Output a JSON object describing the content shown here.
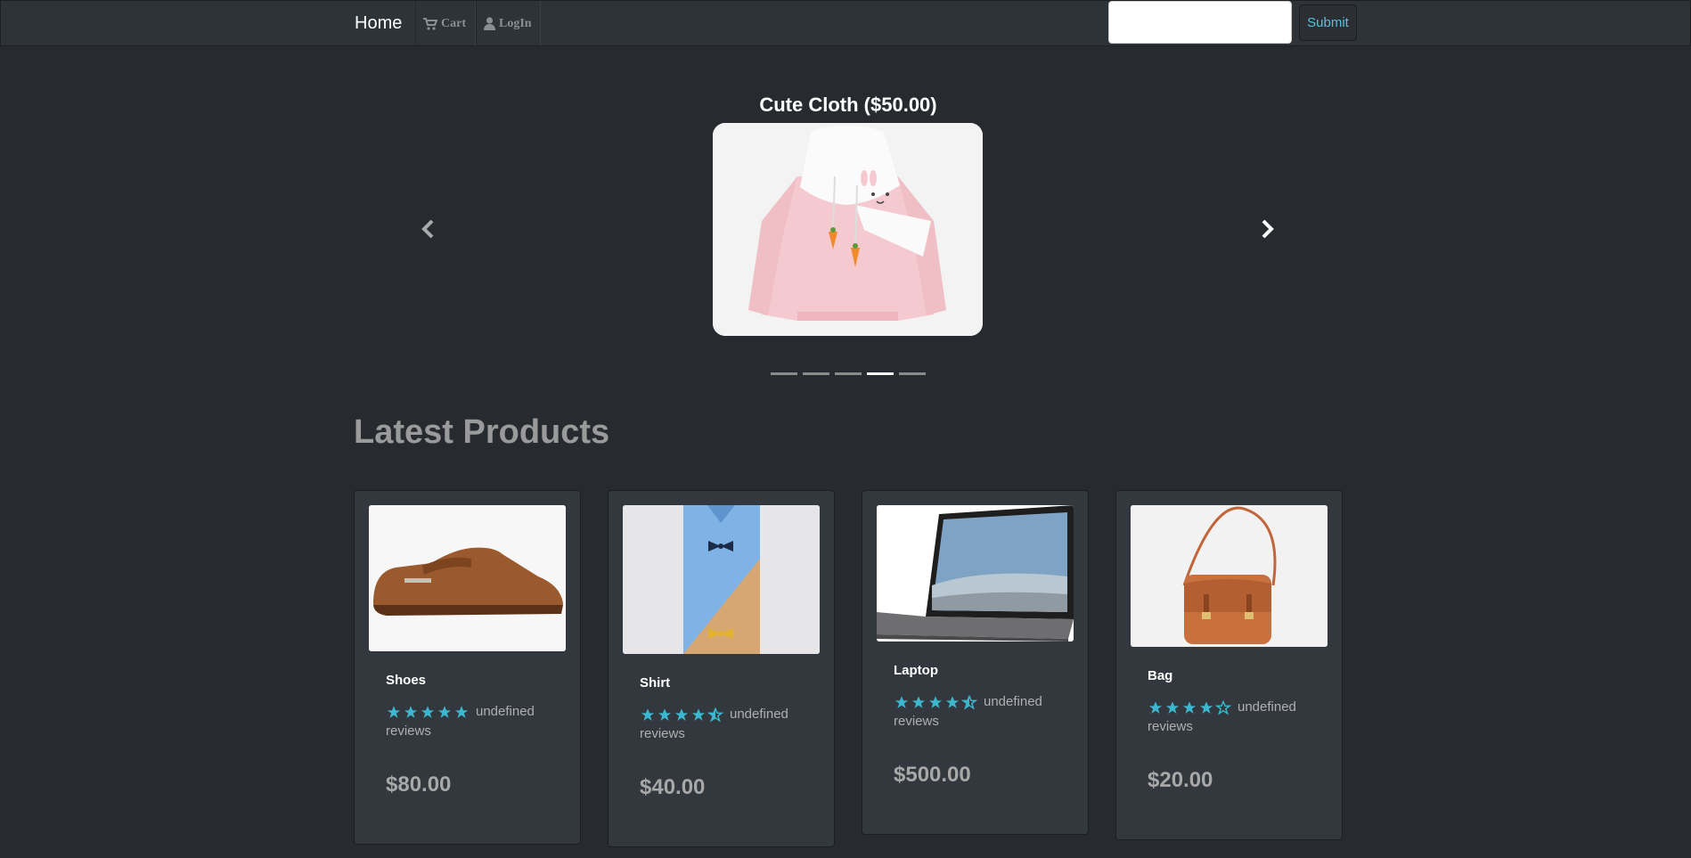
{
  "nav": {
    "brand": "Home",
    "cart_label": "Cart",
    "login_label": "LogIn",
    "search_value": "",
    "submit_label": "Submit"
  },
  "carousel": {
    "caption": "Cute Cloth ($50.00)",
    "slide_count": 5,
    "active_slide_index": 3
  },
  "section_title": "Latest Products",
  "products": [
    {
      "name": "Shoes",
      "rating": 5,
      "reviews_text": "undefined reviews",
      "price": "$80.00"
    },
    {
      "name": "Shirt",
      "rating": 4.5,
      "reviews_text": "undefined reviews",
      "price": "$40.00"
    },
    {
      "name": "Laptop",
      "rating": 4.5,
      "reviews_text": "undefined reviews",
      "price": "$500.00"
    },
    {
      "name": "Bag",
      "rating": 4,
      "reviews_text": "undefined reviews",
      "price": "$20.00"
    }
  ],
  "colors": {
    "background": "#272b30",
    "navbar": "#2e3338",
    "card": "#32383e",
    "star": "#3bb8d0",
    "submit_text": "#5bc0de"
  }
}
